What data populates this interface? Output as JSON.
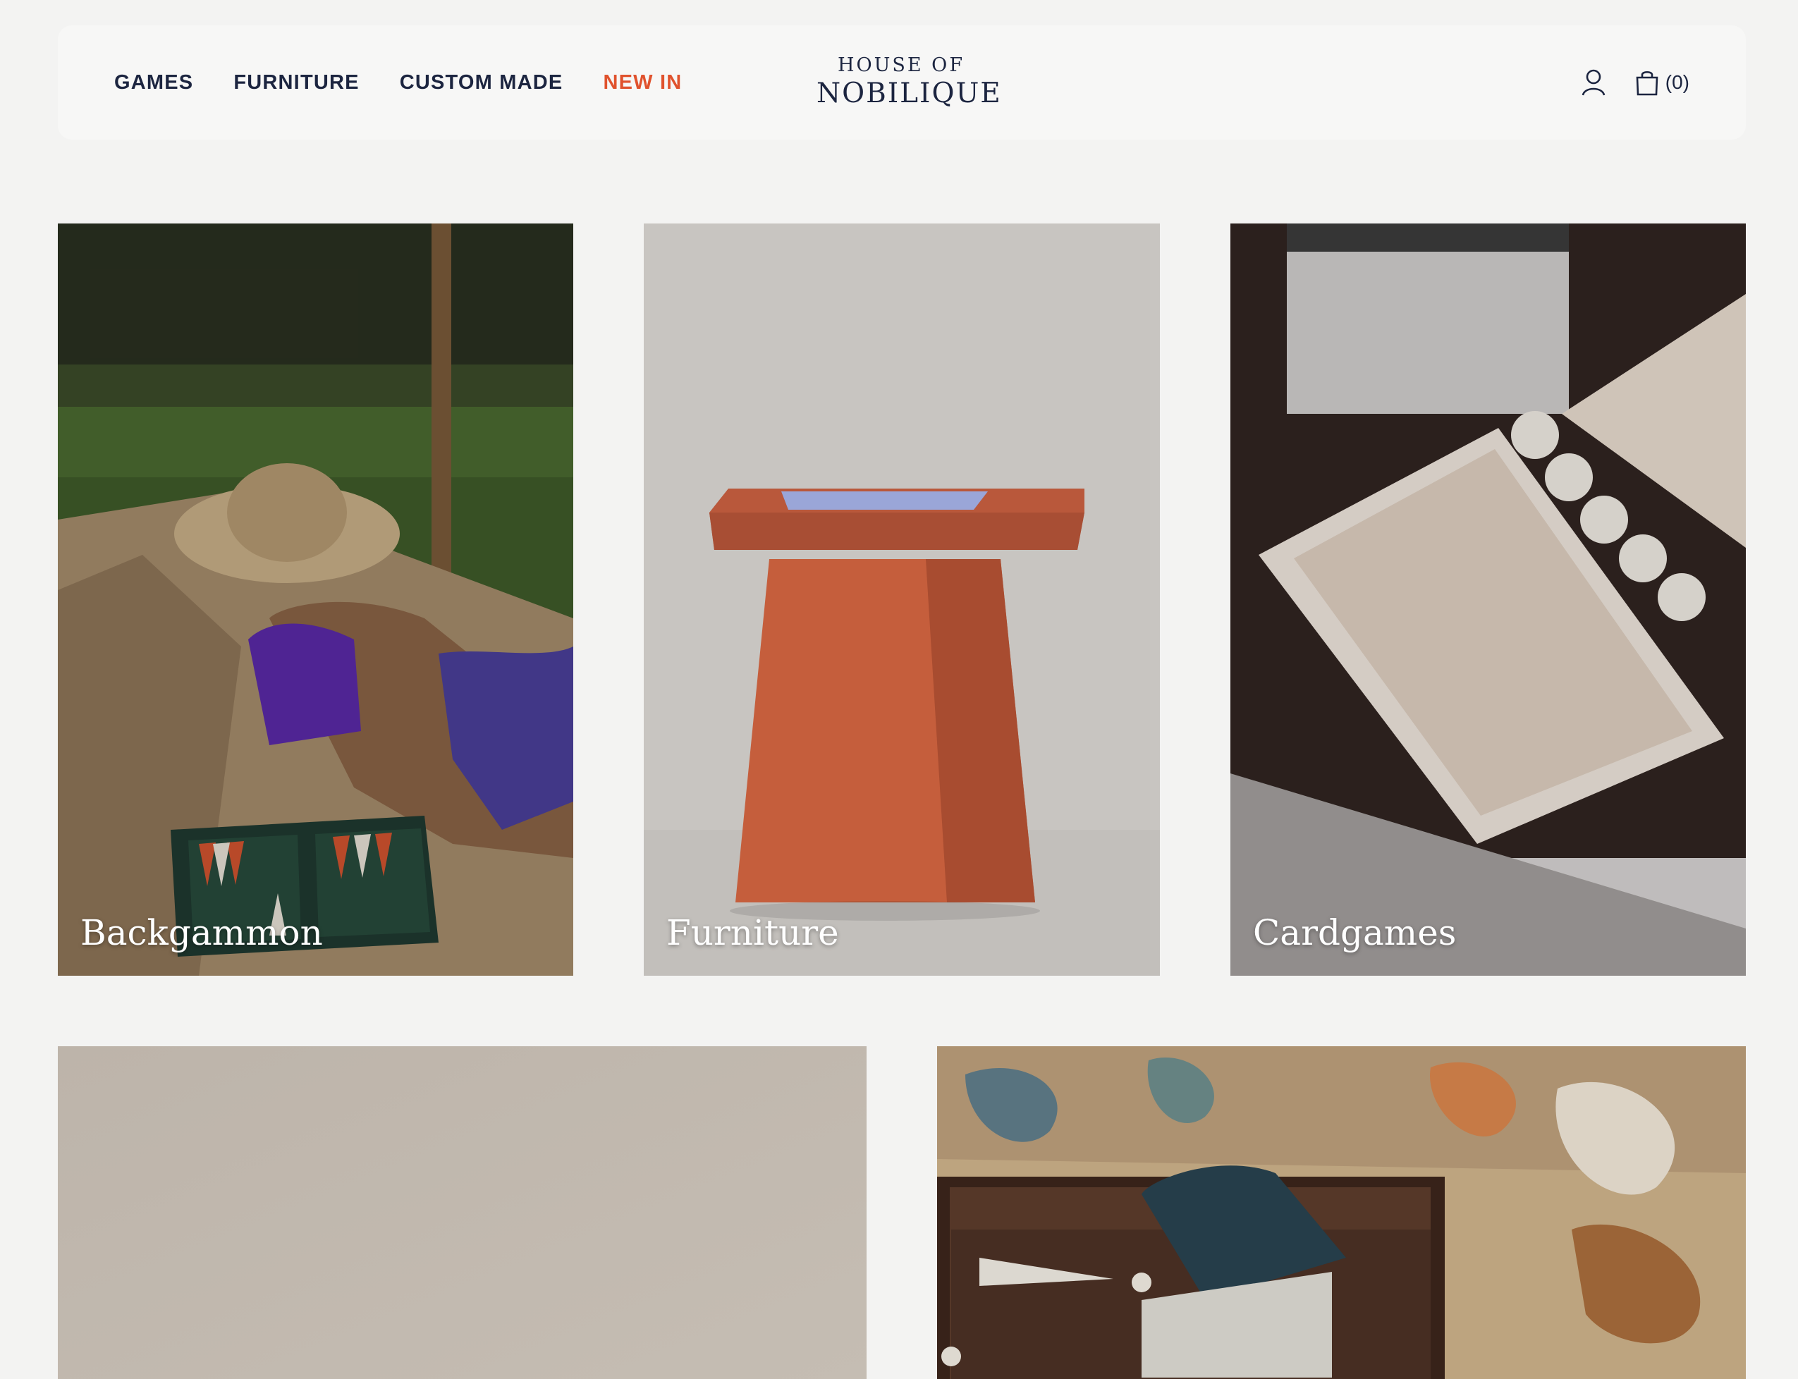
{
  "header": {
    "nav": [
      {
        "label": "GAMES"
      },
      {
        "label": "FURNITURE"
      },
      {
        "label": "CUSTOM MADE"
      },
      {
        "label": "NEW IN",
        "color": "#e0522d"
      }
    ],
    "logo": {
      "line1": "HOUSE OF",
      "line2": "NOBILIQUE"
    },
    "account_icon": "user-icon",
    "cart_icon": "shopping-bag-icon",
    "cart_count": "(0)"
  },
  "tiles": [
    {
      "label": "Backgammon"
    },
    {
      "label": "Furniture"
    },
    {
      "label": "Cardgames"
    },
    {
      "label": ""
    },
    {
      "label": ""
    }
  ],
  "colors": {
    "navy": "#1c2540",
    "accent": "#e0522d",
    "page_bg": "#f3f3f2"
  }
}
